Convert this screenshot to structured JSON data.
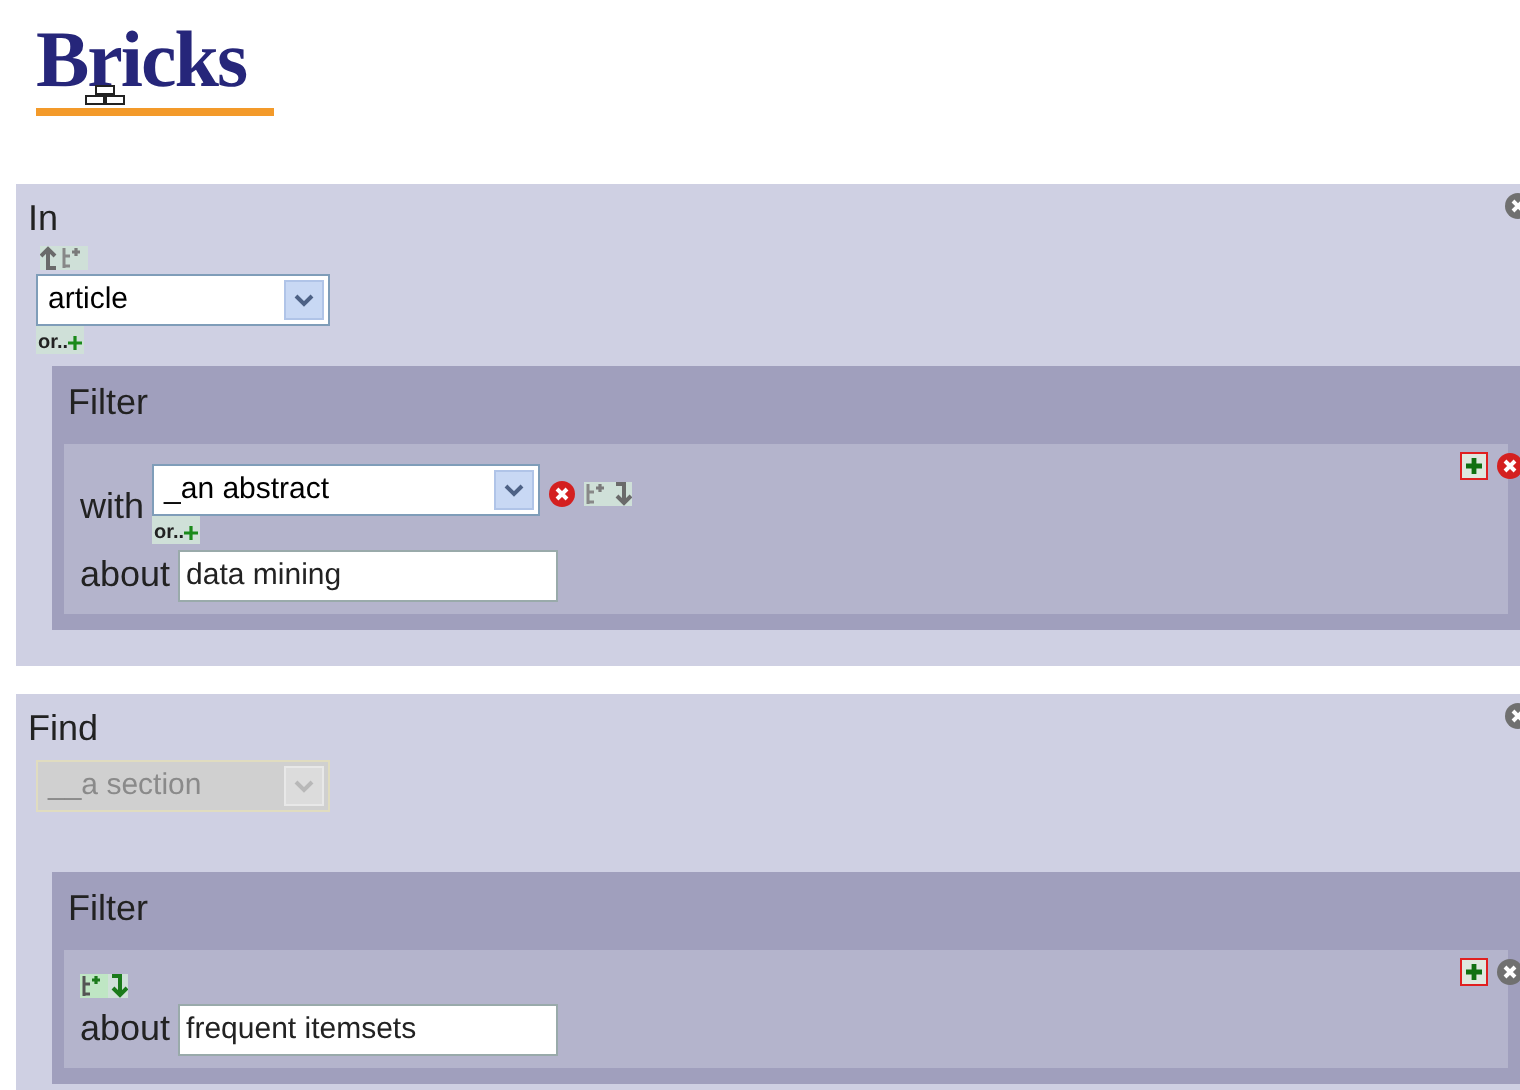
{
  "logo": {
    "text": "Bricks"
  },
  "panels": [
    {
      "title": "In",
      "tools": {
        "enabled": false
      },
      "select": {
        "value": "article",
        "disabled": false
      },
      "or_label": "or..",
      "filter": {
        "title": "Filter",
        "with": {
          "label": "with",
          "value": "_an abstract",
          "or_label": "or..",
          "tools_enabled": false
        },
        "remove_enabled": true,
        "about": {
          "label": "about",
          "value": "data mining"
        }
      }
    },
    {
      "title": "Find",
      "select": {
        "value": "__a section",
        "disabled": true
      },
      "filter": {
        "title": "Filter",
        "tools_enabled": true,
        "remove_enabled": false,
        "about": {
          "label": "about",
          "value": "frequent itemsets"
        }
      }
    }
  ]
}
